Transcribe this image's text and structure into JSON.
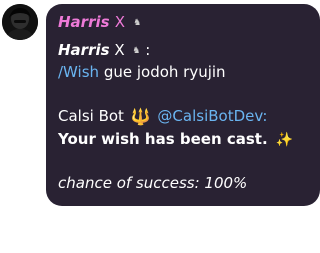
{
  "message": {
    "sender_name": "Harris",
    "sender_suffix": "X",
    "sender_glyph": "♞",
    "reply_user": "Harris",
    "reply_suffix": "X",
    "reply_glyph": "♞",
    "reply_colon": ":",
    "command": "/Wish",
    "command_text": "gue jodoh ryujin",
    "bot_name": "Calsi Bot",
    "bot_icon": "trident-icon",
    "bot_icon_glyph": "🔱",
    "bot_handle": "@CalsiBotDev:",
    "result_text": "Your wish has been cast.",
    "sparkle_glyph": "✨",
    "chance_text": "chance of success: 100%"
  },
  "colors": {
    "bubble_bg": "#292233",
    "sender_name": "#ee7ad8",
    "link": "#6ab4f0",
    "text": "#ffffff"
  }
}
